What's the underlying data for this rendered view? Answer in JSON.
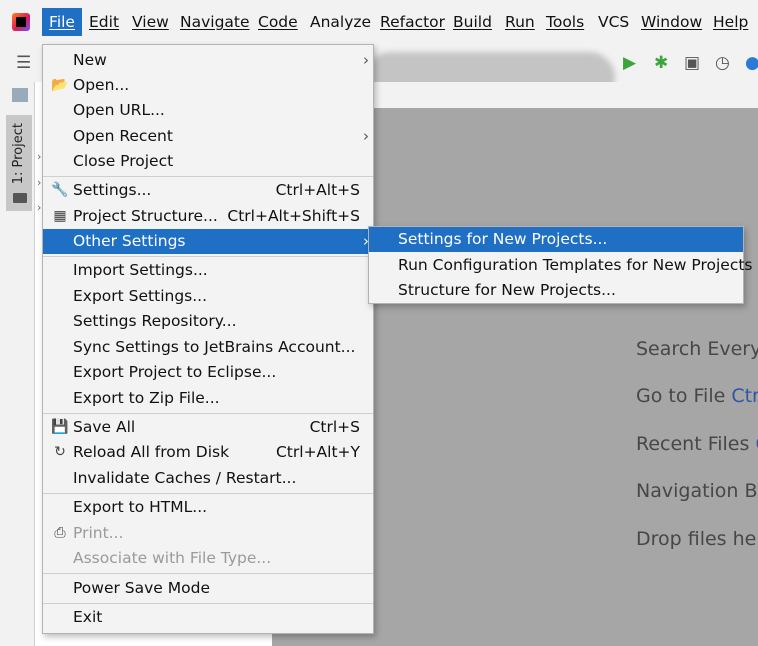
{
  "menubar": {
    "items": [
      {
        "label": "File"
      },
      {
        "label": "Edit"
      },
      {
        "label": "View"
      },
      {
        "label": "Navigate"
      },
      {
        "label": "Code"
      },
      {
        "label": "Analyze"
      },
      {
        "label": "Refactor"
      },
      {
        "label": "Build"
      },
      {
        "label": "Run"
      },
      {
        "label": "Tools"
      },
      {
        "label": "VCS"
      },
      {
        "label": "Window"
      },
      {
        "label": "Help"
      }
    ]
  },
  "toolbar": {
    "icons": [
      "run-icon",
      "debug-icon",
      "coverage-icon",
      "profile-icon",
      "update-icon"
    ]
  },
  "tool_window": {
    "project_tab_label": "1: Project"
  },
  "file_menu": {
    "items": [
      {
        "label": "New",
        "submenu": true
      },
      {
        "label": "Open...",
        "icon": "folder-open-icon"
      },
      {
        "label": "Open URL..."
      },
      {
        "label": "Open Recent",
        "submenu": true
      },
      {
        "label": "Close Project"
      },
      {
        "label": "Settings...",
        "shortcut": "Ctrl+Alt+S",
        "icon": "wrench-icon"
      },
      {
        "label": "Project Structure...",
        "shortcut": "Ctrl+Alt+Shift+S",
        "icon": "project-structure-icon"
      },
      {
        "label": "Other Settings",
        "submenu": true,
        "selected": true
      },
      {
        "label": "Import Settings..."
      },
      {
        "label": "Export Settings..."
      },
      {
        "label": "Settings Repository..."
      },
      {
        "label": "Sync Settings to JetBrains Account..."
      },
      {
        "label": "Export Project to Eclipse..."
      },
      {
        "label": "Export to Zip File..."
      },
      {
        "label": "Save All",
        "shortcut": "Ctrl+S",
        "icon": "save-icon"
      },
      {
        "label": "Reload All from Disk",
        "shortcut": "Ctrl+Alt+Y",
        "icon": "reload-icon"
      },
      {
        "label": "Invalidate Caches / Restart..."
      },
      {
        "label": "Export to HTML..."
      },
      {
        "label": "Print...",
        "disabled": true,
        "icon": "printer-icon"
      },
      {
        "label": "Associate with File Type...",
        "disabled": true
      },
      {
        "label": "Power Save Mode"
      },
      {
        "label": "Exit"
      }
    ]
  },
  "other_settings_submenu": {
    "items": [
      {
        "label": "Settings for New Projects...",
        "selected": true
      },
      {
        "label": "Run Configuration Templates for New Projects"
      },
      {
        "label": "Structure for New Projects..."
      }
    ]
  },
  "editor_hints": {
    "search_everywhere": "Search Everyw",
    "go_to_file": "Go to File",
    "go_to_file_key": "Ctr",
    "recent_files": "Recent Files",
    "recent_files_key": "C",
    "navigation_bar": "Navigation Ba",
    "drop_files": "Drop files her"
  },
  "colors": {
    "selection": "#1f6fc5",
    "editor_background": "#a6a6a6",
    "menu_background": "#f3f3f3",
    "run_green": "#3aa53a",
    "shortcut_key_blue": "#2c57a8"
  }
}
